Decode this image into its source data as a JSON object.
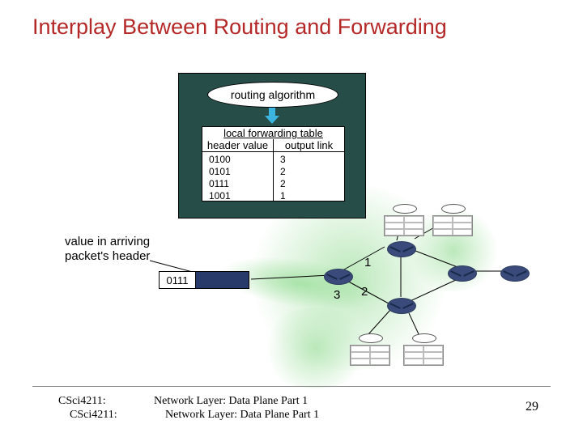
{
  "title": "Interplay Between Routing and Forwarding",
  "router_box": {
    "algorithm_label": "routing algorithm",
    "table": {
      "title": "local forwarding table",
      "col1_header": "header value",
      "col2_header": "output link",
      "rows": [
        {
          "header": "0100",
          "link": "3"
        },
        {
          "header": "0101",
          "link": "2"
        },
        {
          "header": "0111",
          "link": "2"
        },
        {
          "header": "1001",
          "link": "1"
        }
      ]
    }
  },
  "value_label_line1": "value in arriving",
  "value_label_line2": "packet's header",
  "packet_value": "0111",
  "ports": {
    "p1": "1",
    "p2": "2",
    "p3": "3"
  },
  "footer": {
    "left_line1": "CSci4211:",
    "left_line2": "CSci4211:",
    "center_line1": "Network Layer: Data Plane Part 1",
    "center_line2": "Network Layer: Data Plane Part 1",
    "page": "29"
  }
}
